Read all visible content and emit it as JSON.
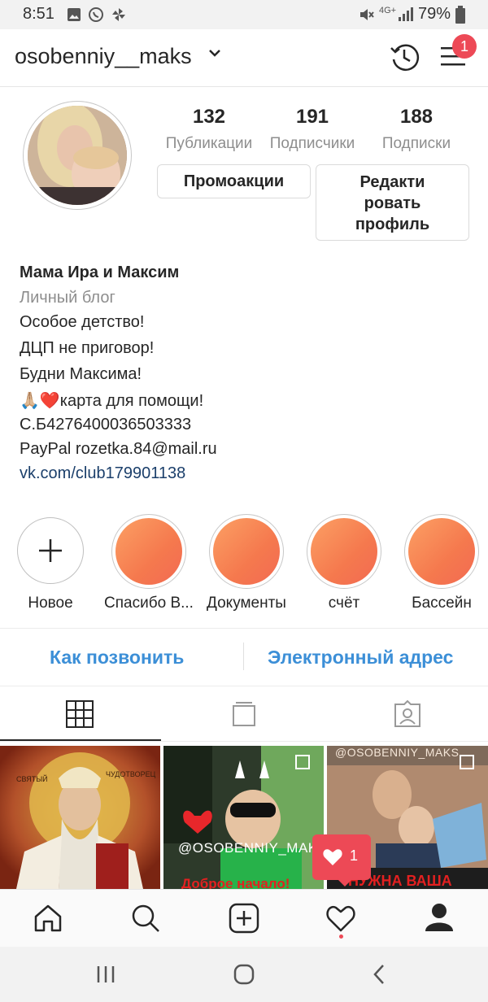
{
  "status_bar": {
    "time": "8:51",
    "battery": "79%",
    "network": "4G+"
  },
  "header": {
    "username": "osobenniy__maks",
    "notification_count": "1"
  },
  "profile": {
    "stats": [
      {
        "value": "132",
        "label": "Публикации"
      },
      {
        "value": "191",
        "label": "Подписчики"
      },
      {
        "value": "188",
        "label": "Подписки"
      }
    ],
    "promo_button": "Промоакции",
    "edit_button": [
      "Редакти",
      "ровать",
      "профиль"
    ]
  },
  "bio": {
    "name": "Мама Ира и Максим",
    "category": "Личный блог",
    "lines": [
      "Особое детство!",
      "ДЦП не приговор!",
      "Будни Максима!",
      "🙏🏼❤️карта для помощи!",
      "С.Б4276400036503333",
      "PayPal rozetka.84@mail.ru"
    ],
    "link": "vk.com/club179901138"
  },
  "highlights": [
    {
      "label": "Новое",
      "type": "new"
    },
    {
      "label": "Спасибо В...",
      "type": "story"
    },
    {
      "label": "Документы",
      "type": "story"
    },
    {
      "label": "счёт",
      "type": "story"
    },
    {
      "label": "Бассейн",
      "type": "story"
    }
  ],
  "contacts": {
    "call": "Как позвонить",
    "email": "Электронный адрес"
  },
  "tabs": [
    "grid-icon",
    "igtv-icon",
    "tagged-icon"
  ],
  "grid": {
    "post1_text_left": "СВЯТЫЙ",
    "post1_text_right": "ЧУДОТВОРЕЦ",
    "post2_watermark": "@OSOBENNIY_MAKS",
    "post2_caption": "Доброе начало!",
    "post3_watermark": "@OSOBENNIY_MAKS",
    "post3_caption": "НУЖНА ВАША"
  },
  "toast": {
    "likes": "1"
  },
  "colors": {
    "accent": "#3c8fd7",
    "badge": "#ed4956",
    "highlight": "#f5794e"
  }
}
